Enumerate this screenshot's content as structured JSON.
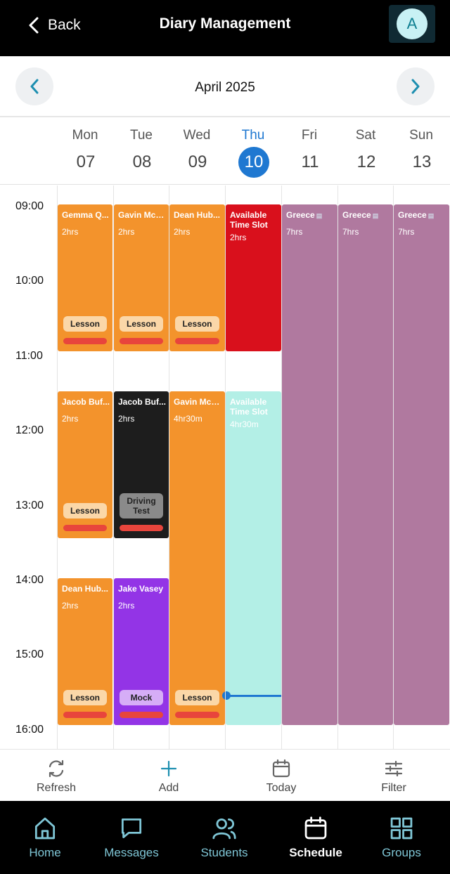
{
  "header": {
    "back_label": "Back",
    "title": "Diary Management",
    "avatar_initial": "A"
  },
  "month_nav": {
    "label": "April 2025"
  },
  "days": [
    {
      "name": "Mon",
      "num": "07"
    },
    {
      "name": "Tue",
      "num": "08"
    },
    {
      "name": "Wed",
      "num": "09"
    },
    {
      "name": "Thu",
      "num": "10",
      "today": true
    },
    {
      "name": "Fri",
      "num": "11"
    },
    {
      "name": "Sat",
      "num": "12"
    },
    {
      "name": "Sun",
      "num": "13"
    }
  ],
  "times": [
    "09:00",
    "10:00",
    "11:00",
    "12:00",
    "13:00",
    "14:00",
    "15:00",
    "16:00"
  ],
  "events": [
    {
      "day": "Mon",
      "start": "09:00",
      "hours": 2,
      "name": "Gemma Q...",
      "duration": "2hrs",
      "tag": "Lesson",
      "color": "#f3932c",
      "tag_color": "#fbd7a8"
    },
    {
      "day": "Tue",
      "start": "09:00",
      "hours": 2,
      "name": "Gavin Mcc...",
      "duration": "2hrs",
      "tag": "Lesson",
      "color": "#f3932c",
      "tag_color": "#fbd7a8"
    },
    {
      "day": "Wed",
      "start": "09:00",
      "hours": 2,
      "name": "Dean Hub...",
      "duration": "2hrs",
      "tag": "Lesson",
      "color": "#f3932c",
      "tag_color": "#fbd7a8"
    },
    {
      "day": "Thu",
      "start": "09:00",
      "hours": 2,
      "name": "Available Time Slot",
      "duration": "2hrs",
      "color": "#d9101c"
    },
    {
      "day": "Fri",
      "start": "09:00",
      "hours": 7,
      "name": "Greece",
      "duration": "7hrs",
      "color": "#b0799f",
      "flag": true
    },
    {
      "day": "Sat",
      "start": "09:00",
      "hours": 7,
      "name": "Greece",
      "duration": "7hrs",
      "color": "#b0799f",
      "flag": true
    },
    {
      "day": "Sun",
      "start": "09:00",
      "hours": 7,
      "name": "Greece",
      "duration": "7hrs",
      "color": "#b0799f",
      "flag": true
    },
    {
      "day": "Mon",
      "start": "11:30",
      "hours": 2,
      "name": "Jacob Buf...",
      "duration": "2hrs",
      "tag": "Lesson",
      "color": "#f3932c",
      "tag_color": "#fbd7a8"
    },
    {
      "day": "Tue",
      "start": "11:30",
      "hours": 2,
      "name": "Jacob Buf...",
      "duration": "2hrs",
      "tag": "Driving Test",
      "color": "#1d1d1d",
      "tag_color": "#8a8a8a"
    },
    {
      "day": "Wed",
      "start": "11:30",
      "hours": 4.5,
      "name": "Gavin Mcc...",
      "duration": "4hr30m",
      "tag": "Lesson",
      "color": "#f3932c",
      "tag_color": "#fbd7a8"
    },
    {
      "day": "Thu",
      "start": "11:30",
      "hours": 4.5,
      "name": "Available Time Slot",
      "duration": "4hr30m",
      "color": "#b3efe6"
    },
    {
      "day": "Mon",
      "start": "14:00",
      "hours": 2,
      "name": "Dean Hub...",
      "duration": "2hrs",
      "tag": "Lesson",
      "color": "#f3932c",
      "tag_color": "#fbd7a8"
    },
    {
      "day": "Tue",
      "start": "14:00",
      "hours": 2,
      "name": "Jake Vasey",
      "duration": "2hrs",
      "tag": "Mock",
      "color": "#9334e6",
      "tag_color": "#d6adf7"
    }
  ],
  "actions": [
    {
      "label": "Refresh",
      "icon": "refresh-icon"
    },
    {
      "label": "Add",
      "icon": "plus-icon"
    },
    {
      "label": "Today",
      "icon": "calendar-icon"
    },
    {
      "label": "Filter",
      "icon": "sliders-icon"
    }
  ],
  "tabs": [
    {
      "label": "Home",
      "icon": "home-icon"
    },
    {
      "label": "Messages",
      "icon": "message-icon"
    },
    {
      "label": "Students",
      "icon": "users-icon"
    },
    {
      "label": "Schedule",
      "icon": "calendar-icon",
      "active": true
    },
    {
      "label": "Groups",
      "icon": "grid-icon"
    }
  ],
  "colors": {
    "accent": "#1f78d1",
    "teal": "#7fc6d6"
  }
}
